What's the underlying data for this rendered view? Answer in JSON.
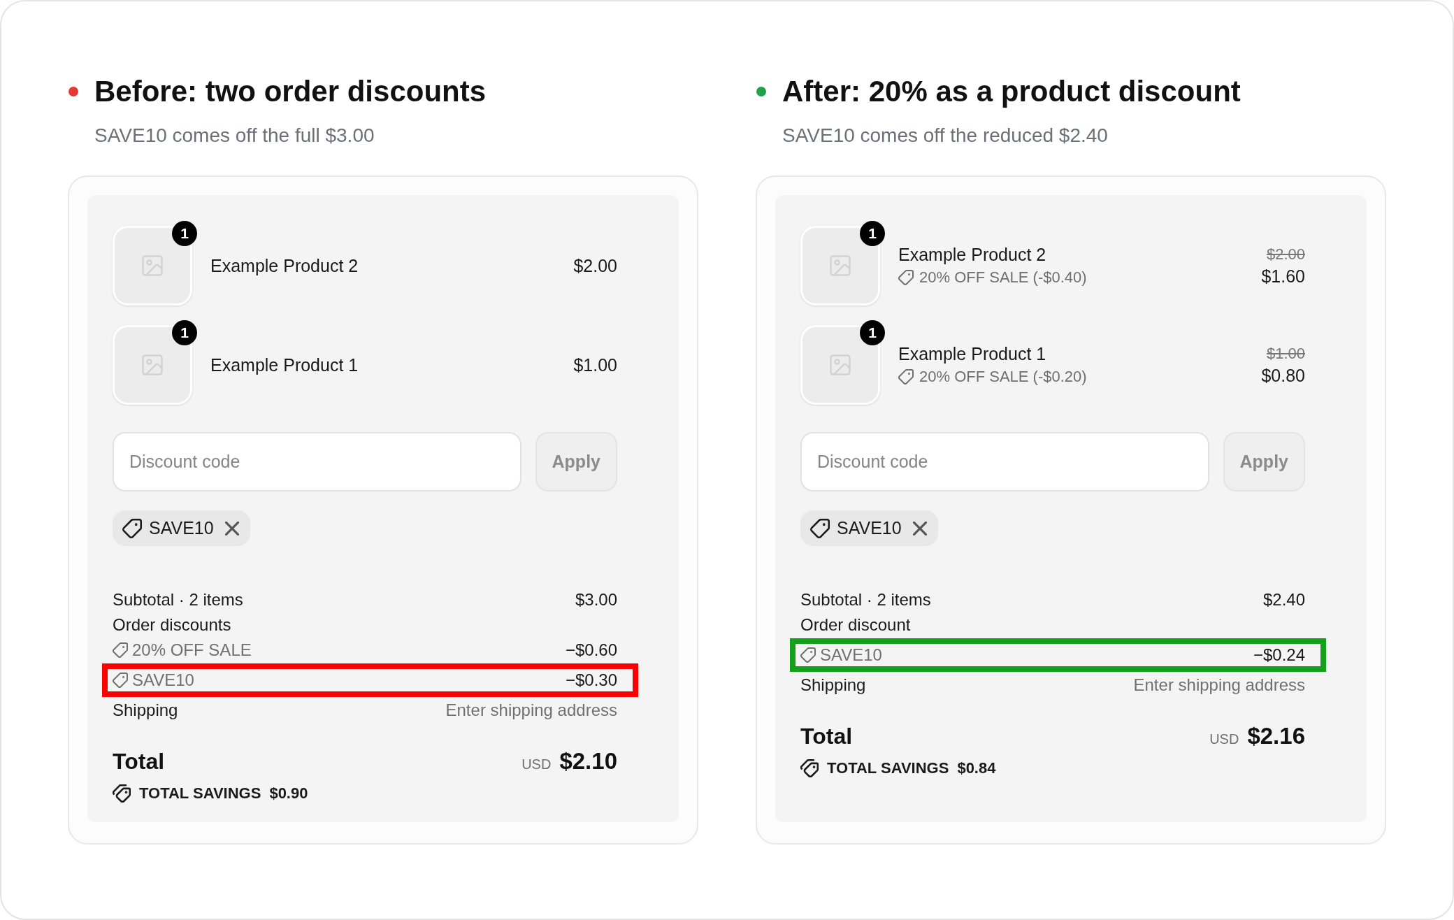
{
  "comparisons": [
    {
      "color": "#e53935",
      "title": "Before: two order discounts",
      "subtitle": "SAVE10 comes off the full $3.00",
      "checkout": {
        "products": [
          {
            "name": "Example Product 2",
            "quantity": "1",
            "price": "$2.00"
          },
          {
            "name": "Example Product 1",
            "quantity": "1",
            "price": "$1.00"
          }
        ],
        "discount_field": {
          "placeholder": "Discount code"
        },
        "apply_button": {
          "label": "Apply",
          "disabled": true
        },
        "applied_code": "SAVE10",
        "summary": {
          "subtotal_label": "Subtotal · 2 items",
          "subtotal": "$3.00",
          "discounts_label": "Order discounts",
          "discounts": [
            {
              "label": "20% OFF SALE",
              "amount": "−$0.60",
              "highlighted": false
            },
            {
              "label": "SAVE10",
              "amount": "−$0.30",
              "highlighted": true,
              "color": "#ff0000"
            }
          ],
          "shipping_label": "Shipping",
          "shipping": "Enter shipping address",
          "total_label": "Total",
          "currency": "USD",
          "total": "$2.10",
          "savings_label": "TOTAL SAVINGS",
          "savings": "$0.90"
        }
      }
    },
    {
      "color": "#22a04a",
      "title": "After: 20% as a product discount",
      "subtitle": "SAVE10 comes off the reduced $2.40",
      "checkout": {
        "products": [
          {
            "name": "Example Product 2",
            "quantity": "1",
            "discount": "20% OFF SALE (-$0.40)",
            "compare_at_price": "$2.00",
            "price": "$1.60"
          },
          {
            "name": "Example Product 1",
            "quantity": "1",
            "discount": "20% OFF SALE (-$0.20)",
            "compare_at_price": "$1.00",
            "price": "$0.80"
          }
        ],
        "discount_field": {
          "placeholder": "Discount code"
        },
        "apply_button": {
          "label": "Apply",
          "disabled": true
        },
        "applied_code": "SAVE10",
        "summary": {
          "subtotal_label": "Subtotal · 2 items",
          "subtotal": "$2.40",
          "discounts_label": "Order discount",
          "discounts": [
            {
              "label": "SAVE10",
              "amount": "−$0.24",
              "highlighted": true,
              "color": "#14a01a"
            }
          ],
          "shipping_label": "Shipping",
          "shipping": "Enter shipping address",
          "total_label": "Total",
          "currency": "USD",
          "total": "$2.16",
          "savings_label": "TOTAL SAVINGS",
          "savings": "$0.84"
        }
      }
    }
  ]
}
